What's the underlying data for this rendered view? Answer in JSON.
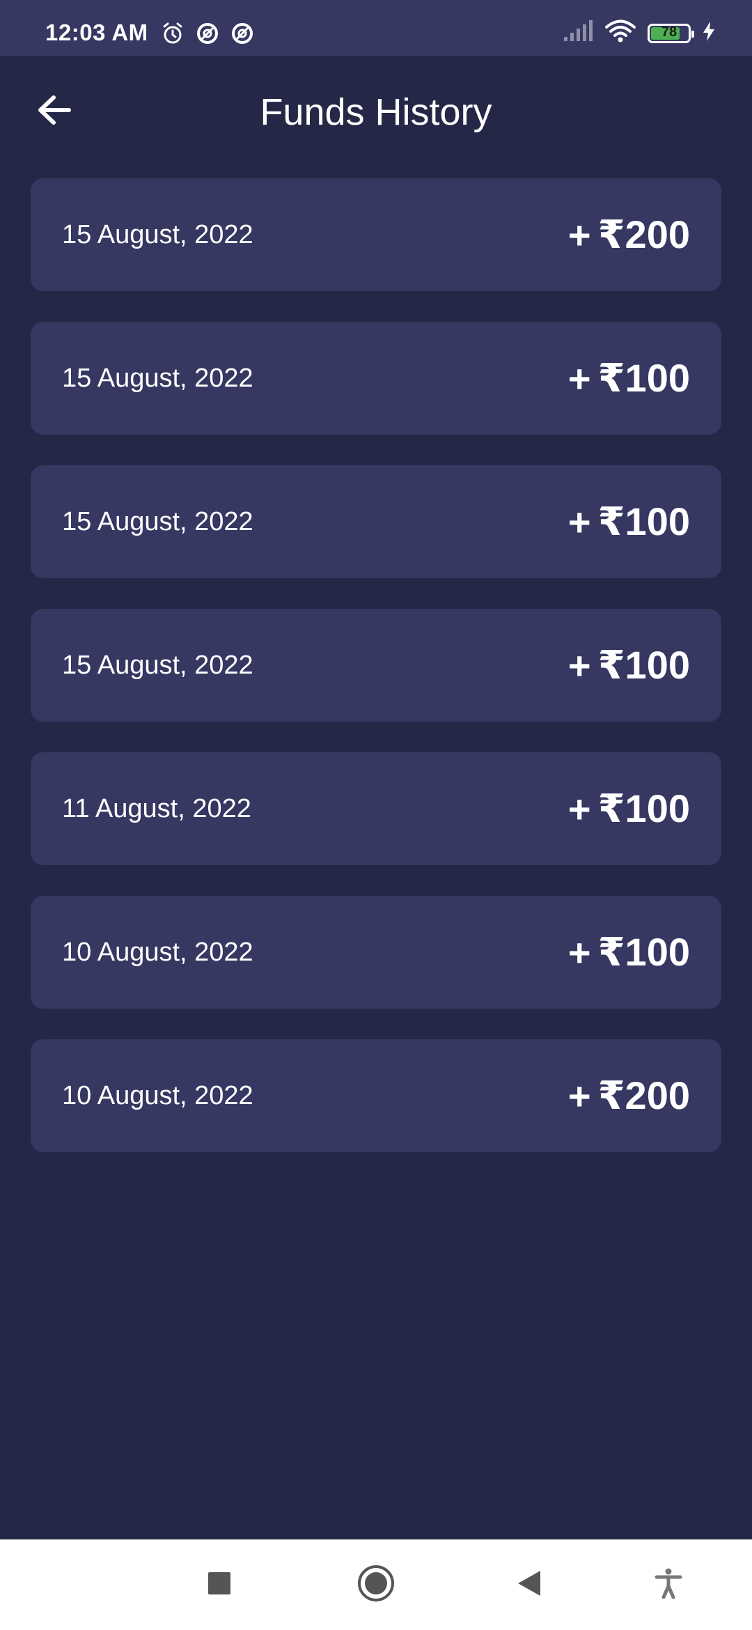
{
  "status_bar": {
    "time": "12:03 AM",
    "battery_level": "78",
    "battery_fraction": 0.78,
    "icons": [
      "alarm-icon",
      "data-saver-icon",
      "data-saver-icon",
      "signal-icon",
      "wifi-icon",
      "battery-icon",
      "charging-icon"
    ]
  },
  "header": {
    "title": "Funds History",
    "back_icon": "arrow-back-icon"
  },
  "funds": [
    {
      "date": "15 August, 2022",
      "sign": "+",
      "amount": "₹200"
    },
    {
      "date": "15 August, 2022",
      "sign": "+",
      "amount": "₹100"
    },
    {
      "date": "15 August, 2022",
      "sign": "+",
      "amount": "₹100"
    },
    {
      "date": "15 August, 2022",
      "sign": "+",
      "amount": "₹100"
    },
    {
      "date": "11 August, 2022",
      "sign": "+",
      "amount": "₹100"
    },
    {
      "date": "10 August, 2022",
      "sign": "+",
      "amount": "₹100"
    },
    {
      "date": "10 August, 2022",
      "sign": "+",
      "amount": "₹200"
    }
  ],
  "nav_bar": {
    "icons": [
      "recents-icon",
      "home-icon",
      "back-icon",
      "accessibility-icon"
    ]
  },
  "colors": {
    "background": "#252746",
    "card": "#363862",
    "status_bar": "#363862",
    "text": "#ffffff",
    "battery_fill": "#4caf50"
  }
}
